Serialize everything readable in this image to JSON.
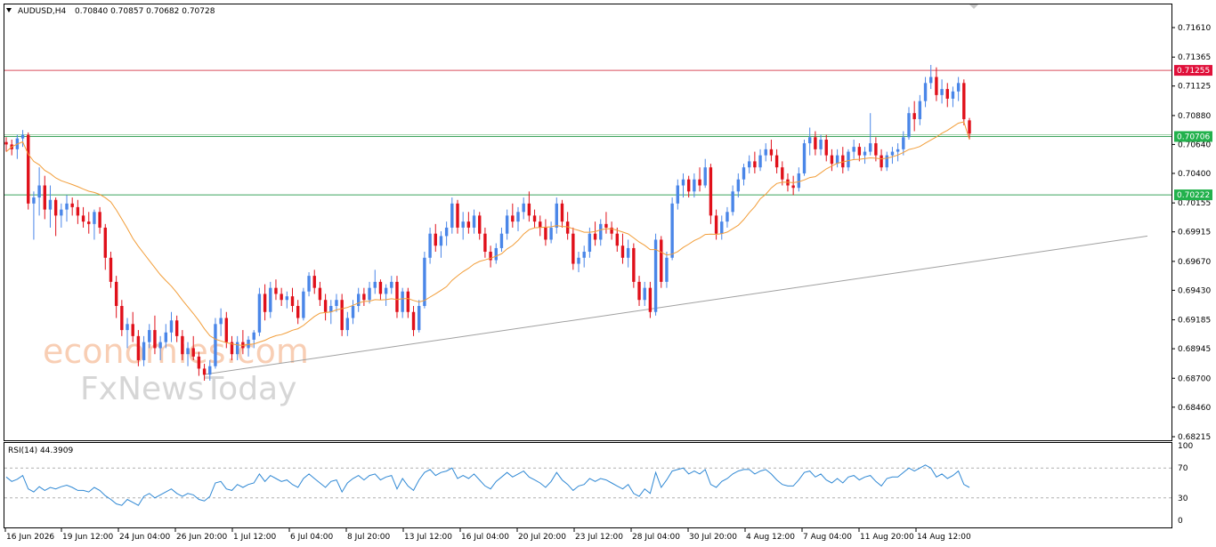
{
  "header": {
    "symbol": "AUDUSD,H4",
    "ohlc": "0.70840 0.70857 0.70682 0.70728"
  },
  "watermark": {
    "line1": "economies.com",
    "line2": "FxNewsToday"
  },
  "price_scale": [
    "0.71610",
    "0.71365",
    "0.71125",
    "0.70880",
    "0.70640",
    "0.70400",
    "0.70155",
    "0.69915",
    "0.69670",
    "0.69430",
    "0.69185",
    "0.68945",
    "0.68700",
    "0.68460",
    "0.68215"
  ],
  "price_labels": [
    {
      "text": "0.71255",
      "value": 0.71255,
      "color": "#e0103a"
    },
    {
      "text": "0.70706",
      "value": 0.70706,
      "color": "#22b14c"
    },
    {
      "text": "0.70222",
      "value": 0.70222,
      "color": "#22b14c"
    }
  ],
  "rsi": {
    "label": "RSI(14) 44.3909",
    "scale": [
      "100",
      "70",
      "30",
      "0"
    ]
  },
  "time_labels": [
    "16 Jun 2026",
    "19 Jun 12:00",
    "24 Jun 04:00",
    "26 Jun 20:00",
    "1 Jul 12:00",
    "6 Jul 04:00",
    "8 Jul 20:00",
    "13 Jul 12:00",
    "16 Jul 04:00",
    "20 Jul 20:00",
    "23 Jul 12:00",
    "28 Jul 04:00",
    "30 Jul 20:00",
    "4 Aug 12:00",
    "7 Aug 04:00",
    "11 Aug 20:00",
    "14 Aug 12:00"
  ],
  "colors": {
    "bull": "#4a86e8",
    "bear": "#e0101a",
    "ma": "#f29d38",
    "resistance": "#d94d5c",
    "support": "#3da35d",
    "trend": "#a0a0a0",
    "rsi": "#2f88d4",
    "watermark_orange": "#f7c6a8",
    "watermark_gray": "#cfcfcf"
  },
  "chart_data": {
    "type": "candlestick",
    "symbol": "AUDUSD",
    "timeframe": "H4",
    "ylim": [
      0.68215,
      0.7175
    ],
    "horizontal_levels": [
      0.71255,
      0.70706,
      0.70222
    ],
    "trendline": [
      [
        0,
        0.6873
      ],
      [
        210,
        0.6988
      ]
    ],
    "candles": [
      [
        0.7066,
        0.707,
        0.7058,
        0.7064
      ],
      [
        0.7064,
        0.7068,
        0.7055,
        0.706
      ],
      [
        0.706,
        0.7072,
        0.7052,
        0.7069
      ],
      [
        0.7069,
        0.7076,
        0.7062,
        0.7072
      ],
      [
        0.7072,
        0.7074,
        0.701,
        0.7015
      ],
      [
        0.7015,
        0.7025,
        0.6985,
        0.702
      ],
      [
        0.702,
        0.7045,
        0.7005,
        0.703
      ],
      [
        0.703,
        0.7038,
        0.7002,
        0.701
      ],
      [
        0.701,
        0.703,
        0.6995,
        0.7018
      ],
      [
        0.7018,
        0.702,
        0.6988,
        0.7005
      ],
      [
        0.7005,
        0.7015,
        0.6995,
        0.701
      ],
      [
        0.701,
        0.7022,
        0.7,
        0.7015
      ],
      [
        0.7015,
        0.702,
        0.7005,
        0.7012
      ],
      [
        0.7012,
        0.7018,
        0.6998,
        0.7005
      ],
      [
        0.7005,
        0.7012,
        0.6995,
        0.7
      ],
      [
        0.7,
        0.7008,
        0.699,
        0.6998
      ],
      [
        0.6998,
        0.701,
        0.6985,
        0.7008
      ],
      [
        0.7008,
        0.7012,
        0.699,
        0.6995
      ],
      [
        0.6995,
        0.6998,
        0.696,
        0.697
      ],
      [
        0.697,
        0.6975,
        0.6945,
        0.695
      ],
      [
        0.695,
        0.6955,
        0.692,
        0.693
      ],
      [
        0.693,
        0.6935,
        0.6905,
        0.691
      ],
      [
        0.691,
        0.692,
        0.6895,
        0.6915
      ],
      [
        0.6915,
        0.6925,
        0.69,
        0.6905
      ],
      [
        0.6905,
        0.691,
        0.688,
        0.6885
      ],
      [
        0.6885,
        0.6905,
        0.688,
        0.69
      ],
      [
        0.69,
        0.6915,
        0.6895,
        0.691
      ],
      [
        0.691,
        0.6922,
        0.689,
        0.6895
      ],
      [
        0.6895,
        0.6905,
        0.6885,
        0.69
      ],
      [
        0.69,
        0.6915,
        0.6895,
        0.6908
      ],
      [
        0.6908,
        0.6925,
        0.69,
        0.6918
      ],
      [
        0.6918,
        0.6922,
        0.69,
        0.6905
      ],
      [
        0.6905,
        0.691,
        0.6885,
        0.689
      ],
      [
        0.689,
        0.69,
        0.688,
        0.6895
      ],
      [
        0.6895,
        0.6905,
        0.6885,
        0.6888
      ],
      [
        0.6888,
        0.6892,
        0.6872,
        0.6878
      ],
      [
        0.6878,
        0.6882,
        0.6868,
        0.6873
      ],
      [
        0.6873,
        0.6885,
        0.6868,
        0.688
      ],
      [
        0.688,
        0.692,
        0.6878,
        0.6915
      ],
      [
        0.6915,
        0.6928,
        0.6905,
        0.692
      ],
      [
        0.692,
        0.6925,
        0.6895,
        0.69
      ],
      [
        0.69,
        0.6905,
        0.6885,
        0.689
      ],
      [
        0.689,
        0.6905,
        0.6885,
        0.69
      ],
      [
        0.69,
        0.691,
        0.689,
        0.6895
      ],
      [
        0.6895,
        0.6905,
        0.6888,
        0.6902
      ],
      [
        0.6902,
        0.691,
        0.6895,
        0.6908
      ],
      [
        0.6908,
        0.6945,
        0.6905,
        0.694
      ],
      [
        0.694,
        0.6948,
        0.6918,
        0.6925
      ],
      [
        0.6925,
        0.695,
        0.692,
        0.6945
      ],
      [
        0.6945,
        0.6952,
        0.6935,
        0.694
      ],
      [
        0.694,
        0.6945,
        0.693,
        0.6935
      ],
      [
        0.6935,
        0.6942,
        0.6928,
        0.6938
      ],
      [
        0.6938,
        0.6945,
        0.6925,
        0.693
      ],
      [
        0.693,
        0.6935,
        0.6915,
        0.692
      ],
      [
        0.692,
        0.6945,
        0.6918,
        0.6942
      ],
      [
        0.6942,
        0.6958,
        0.6938,
        0.6955
      ],
      [
        0.6955,
        0.696,
        0.694,
        0.6945
      ],
      [
        0.6945,
        0.695,
        0.693,
        0.6935
      ],
      [
        0.6935,
        0.694,
        0.6918,
        0.6925
      ],
      [
        0.6925,
        0.6935,
        0.6915,
        0.693
      ],
      [
        0.693,
        0.694,
        0.6925,
        0.6935
      ],
      [
        0.6935,
        0.694,
        0.6905,
        0.691
      ],
      [
        0.691,
        0.6925,
        0.6905,
        0.692
      ],
      [
        0.692,
        0.6935,
        0.6915,
        0.693
      ],
      [
        0.693,
        0.6945,
        0.6925,
        0.694
      ],
      [
        0.694,
        0.6945,
        0.693,
        0.6935
      ],
      [
        0.6935,
        0.695,
        0.6932,
        0.6945
      ],
      [
        0.6945,
        0.696,
        0.694,
        0.695
      ],
      [
        0.695,
        0.6952,
        0.6935,
        0.694
      ],
      [
        0.694,
        0.6948,
        0.693,
        0.6945
      ],
      [
        0.6945,
        0.6955,
        0.694,
        0.695
      ],
      [
        0.695,
        0.6955,
        0.692,
        0.6925
      ],
      [
        0.6925,
        0.6945,
        0.692,
        0.6942
      ],
      [
        0.6942,
        0.6945,
        0.692,
        0.6925
      ],
      [
        0.6925,
        0.693,
        0.6905,
        0.691
      ],
      [
        0.691,
        0.6935,
        0.6908,
        0.693
      ],
      [
        0.693,
        0.6975,
        0.6928,
        0.697
      ],
      [
        0.697,
        0.6995,
        0.6965,
        0.699
      ],
      [
        0.699,
        0.6998,
        0.6975,
        0.698
      ],
      [
        0.698,
        0.6992,
        0.697,
        0.6988
      ],
      [
        0.6988,
        0.7,
        0.698,
        0.6995
      ],
      [
        0.6995,
        0.702,
        0.699,
        0.7015
      ],
      [
        0.7015,
        0.7018,
        0.699,
        0.6995
      ],
      [
        0.6995,
        0.7008,
        0.6985,
        0.7
      ],
      [
        0.7,
        0.7008,
        0.699,
        0.6995
      ],
      [
        0.6995,
        0.701,
        0.699,
        0.7005
      ],
      [
        0.7005,
        0.7008,
        0.6985,
        0.699
      ],
      [
        0.699,
        0.6995,
        0.697,
        0.6975
      ],
      [
        0.6975,
        0.698,
        0.6962,
        0.6968
      ],
      [
        0.6968,
        0.6982,
        0.6965,
        0.6978
      ],
      [
        0.6978,
        0.6995,
        0.6975,
        0.699
      ],
      [
        0.699,
        0.701,
        0.6985,
        0.7005
      ],
      [
        0.7005,
        0.7015,
        0.6995,
        0.7
      ],
      [
        0.7,
        0.7012,
        0.6992,
        0.7008
      ],
      [
        0.7008,
        0.702,
        0.7002,
        0.7015
      ],
      [
        0.7015,
        0.7025,
        0.7,
        0.7005
      ],
      [
        0.7005,
        0.701,
        0.6995,
        0.7
      ],
      [
        0.7,
        0.7005,
        0.6988,
        0.6995
      ],
      [
        0.6995,
        0.7002,
        0.698,
        0.6985
      ],
      [
        0.6985,
        0.7,
        0.6982,
        0.6995
      ],
      [
        0.6995,
        0.702,
        0.699,
        0.7015
      ],
      [
        0.7015,
        0.7018,
        0.6995,
        0.7
      ],
      [
        0.7,
        0.7008,
        0.6985,
        0.699
      ],
      [
        0.699,
        0.6995,
        0.696,
        0.6965
      ],
      [
        0.6965,
        0.6975,
        0.6958,
        0.697
      ],
      [
        0.697,
        0.698,
        0.6962,
        0.6975
      ],
      [
        0.6975,
        0.6995,
        0.697,
        0.699
      ],
      [
        0.699,
        0.7,
        0.698,
        0.6985
      ],
      [
        0.6985,
        0.7002,
        0.698,
        0.6998
      ],
      [
        0.6998,
        0.7008,
        0.699,
        0.6995
      ],
      [
        0.6995,
        0.7,
        0.6985,
        0.699
      ],
      [
        0.699,
        0.6995,
        0.6975,
        0.698
      ],
      [
        0.698,
        0.699,
        0.6965,
        0.697
      ],
      [
        0.697,
        0.6985,
        0.6962,
        0.6978
      ],
      [
        0.6978,
        0.6982,
        0.6945,
        0.695
      ],
      [
        0.695,
        0.6955,
        0.693,
        0.6935
      ],
      [
        0.6935,
        0.695,
        0.693,
        0.6945
      ],
      [
        0.6945,
        0.695,
        0.692,
        0.6925
      ],
      [
        0.6925,
        0.699,
        0.6922,
        0.6985
      ],
      [
        0.6985,
        0.6988,
        0.6945,
        0.695
      ],
      [
        0.695,
        0.6975,
        0.6945,
        0.697
      ],
      [
        0.697,
        0.702,
        0.6968,
        0.7015
      ],
      [
        0.7015,
        0.7035,
        0.701,
        0.703
      ],
      [
        0.703,
        0.704,
        0.702,
        0.7035
      ],
      [
        0.7035,
        0.7038,
        0.702,
        0.7025
      ],
      [
        0.7025,
        0.704,
        0.702,
        0.7035
      ],
      [
        0.7035,
        0.7045,
        0.7025,
        0.703
      ],
      [
        0.703,
        0.7052,
        0.7028,
        0.7045
      ],
      [
        0.7045,
        0.7048,
        0.6998,
        0.7005
      ],
      [
        0.7005,
        0.701,
        0.6985,
        0.699
      ],
      [
        0.699,
        0.7005,
        0.6985,
        0.7
      ],
      [
        0.7,
        0.7012,
        0.6995,
        0.7008
      ],
      [
        0.7008,
        0.703,
        0.7005,
        0.7025
      ],
      [
        0.7025,
        0.704,
        0.702,
        0.7035
      ],
      [
        0.7035,
        0.7048,
        0.703,
        0.7045
      ],
      [
        0.7045,
        0.7055,
        0.704,
        0.705
      ],
      [
        0.705,
        0.7058,
        0.704,
        0.7045
      ],
      [
        0.7045,
        0.706,
        0.7042,
        0.7055
      ],
      [
        0.7055,
        0.7065,
        0.705,
        0.706
      ],
      [
        0.706,
        0.7068,
        0.705,
        0.7055
      ],
      [
        0.7055,
        0.706,
        0.704,
        0.7045
      ],
      [
        0.7045,
        0.705,
        0.703,
        0.7035
      ],
      [
        0.7035,
        0.704,
        0.7025,
        0.703
      ],
      [
        0.703,
        0.7038,
        0.7022,
        0.7028
      ],
      [
        0.7028,
        0.7045,
        0.7025,
        0.704
      ],
      [
        0.704,
        0.7068,
        0.7038,
        0.7065
      ],
      [
        0.7065,
        0.7078,
        0.7055,
        0.707
      ],
      [
        0.707,
        0.7075,
        0.7055,
        0.706
      ],
      [
        0.706,
        0.7072,
        0.7055,
        0.7068
      ],
      [
        0.7068,
        0.7072,
        0.705,
        0.7055
      ],
      [
        0.7055,
        0.706,
        0.7042,
        0.7048
      ],
      [
        0.7048,
        0.706,
        0.7045,
        0.7055
      ],
      [
        0.7055,
        0.7062,
        0.704,
        0.7045
      ],
      [
        0.7045,
        0.706,
        0.7042,
        0.7058
      ],
      [
        0.7058,
        0.7068,
        0.7052,
        0.7062
      ],
      [
        0.7062,
        0.7065,
        0.705,
        0.7055
      ],
      [
        0.7055,
        0.7062,
        0.7048,
        0.7058
      ],
      [
        0.7058,
        0.709,
        0.7055,
        0.7065
      ],
      [
        0.7065,
        0.707,
        0.705,
        0.7055
      ],
      [
        0.7055,
        0.706,
        0.7042,
        0.7045
      ],
      [
        0.7045,
        0.7058,
        0.7042,
        0.7055
      ],
      [
        0.7055,
        0.7062,
        0.7048,
        0.7058
      ],
      [
        0.7058,
        0.7065,
        0.705,
        0.706
      ],
      [
        0.706,
        0.7075,
        0.7055,
        0.707
      ],
      [
        0.707,
        0.7095,
        0.7068,
        0.709
      ],
      [
        0.709,
        0.71,
        0.7075,
        0.7085
      ],
      [
        0.7085,
        0.7105,
        0.708,
        0.71
      ],
      [
        0.71,
        0.712,
        0.7095,
        0.7115
      ],
      [
        0.7115,
        0.713,
        0.711,
        0.712
      ],
      [
        0.712,
        0.7128,
        0.71,
        0.7105
      ],
      [
        0.7105,
        0.7118,
        0.7098,
        0.711
      ],
      [
        0.711,
        0.7115,
        0.7095,
        0.7102
      ],
      [
        0.7102,
        0.7112,
        0.7095,
        0.7108
      ],
      [
        0.7108,
        0.712,
        0.71,
        0.7115
      ],
      [
        0.7115,
        0.7118,
        0.708,
        0.7085
      ],
      [
        0.7084,
        0.7086,
        0.7068,
        0.7073
      ]
    ],
    "moving_average_first": 0.7058,
    "moving_average_last": 0.7068,
    "rsi_values": [
      58,
      52,
      55,
      60,
      42,
      38,
      45,
      40,
      44,
      42,
      45,
      47,
      44,
      40,
      40,
      38,
      44,
      40,
      33,
      28,
      22,
      20,
      28,
      24,
      20,
      32,
      36,
      30,
      34,
      38,
      42,
      36,
      32,
      36,
      34,
      28,
      26,
      32,
      50,
      52,
      42,
      40,
      48,
      44,
      48,
      50,
      62,
      52,
      60,
      56,
      52,
      54,
      48,
      44,
      56,
      62,
      56,
      50,
      44,
      52,
      54,
      38,
      50,
      56,
      60,
      54,
      60,
      62,
      54,
      58,
      60,
      42,
      56,
      46,
      40,
      54,
      64,
      68,
      60,
      64,
      66,
      70,
      56,
      60,
      56,
      62,
      54,
      46,
      42,
      52,
      58,
      64,
      58,
      62,
      66,
      58,
      54,
      50,
      44,
      52,
      64,
      54,
      48,
      40,
      46,
      48,
      56,
      52,
      56,
      54,
      50,
      46,
      42,
      48,
      36,
      32,
      42,
      36,
      64,
      44,
      54,
      66,
      68,
      70,
      62,
      66,
      62,
      68,
      48,
      44,
      52,
      56,
      62,
      66,
      68,
      68,
      62,
      66,
      68,
      62,
      54,
      48,
      46,
      46,
      54,
      64,
      66,
      58,
      62,
      54,
      50,
      56,
      50,
      58,
      60,
      54,
      58,
      60,
      52,
      46,
      56,
      58,
      58,
      64,
      70,
      66,
      70,
      74,
      70,
      58,
      62,
      56,
      60,
      66,
      48,
      44
    ]
  }
}
